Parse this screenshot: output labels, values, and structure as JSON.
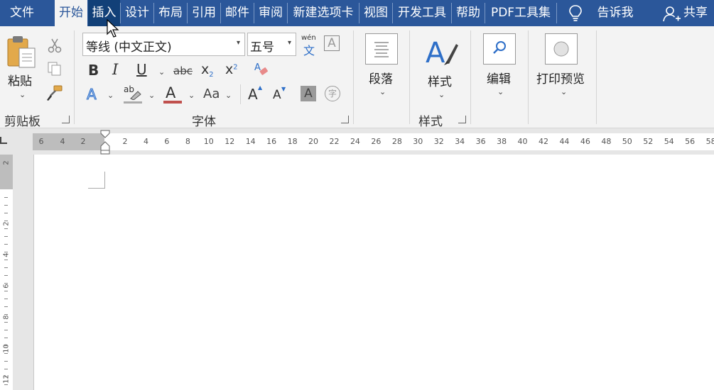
{
  "tabs": [
    {
      "label": "文件",
      "state": "normal"
    },
    {
      "label": "开始",
      "state": "active"
    },
    {
      "label": "插入",
      "state": "hover"
    },
    {
      "label": "设计",
      "state": "normal"
    },
    {
      "label": "布局",
      "state": "normal"
    },
    {
      "label": "引用",
      "state": "normal"
    },
    {
      "label": "邮件",
      "state": "normal"
    },
    {
      "label": "审阅",
      "state": "normal"
    },
    {
      "label": "新建选项卡",
      "state": "normal"
    },
    {
      "label": "视图",
      "state": "normal"
    },
    {
      "label": "开发工具",
      "state": "normal"
    },
    {
      "label": "帮助",
      "state": "normal"
    },
    {
      "label": "PDF工具集",
      "state": "normal"
    }
  ],
  "tell_me": "告诉我",
  "share": "共享",
  "clipboard": {
    "paste": "粘贴",
    "group": "剪贴板"
  },
  "font": {
    "name": "等线 (中文正文)",
    "size": "五号",
    "group": "字体",
    "phonetic_top": "wén",
    "phonetic_bottom": "文",
    "bold": "B",
    "italic": "I",
    "underline": "U",
    "strike": "abc",
    "subscript": "x",
    "sub_mark": "2",
    "superscript": "x",
    "sup_mark": "2",
    "text_effect": "A",
    "highlight": "ab",
    "font_color": "A",
    "change_case": "Aa",
    "grow": "A",
    "shrink": "A",
    "shade": "A",
    "enclose": "字",
    "border_char": "A"
  },
  "paragraph": {
    "label": "段落"
  },
  "styles": {
    "label": "样式",
    "group": "样式"
  },
  "editing": {
    "label": "编辑"
  },
  "print_preview": {
    "label": "打印预览"
  },
  "ruler": {
    "left_nums": [
      "6",
      "4",
      "2"
    ],
    "right_nums": [
      "2",
      "4",
      "6",
      "8",
      "10",
      "12",
      "14",
      "16",
      "18",
      "20",
      "22",
      "24",
      "26",
      "28",
      "30",
      "32",
      "34",
      "36",
      "38",
      "40",
      "42",
      "44",
      "46",
      "48",
      "50",
      "52",
      "54",
      "56",
      "58"
    ],
    "vertical_nums": [
      "2",
      "2",
      "4",
      "6",
      "8",
      "10",
      "12"
    ]
  },
  "colors": {
    "accent": "#2b579a",
    "font_color_bar": "#c0504d"
  }
}
